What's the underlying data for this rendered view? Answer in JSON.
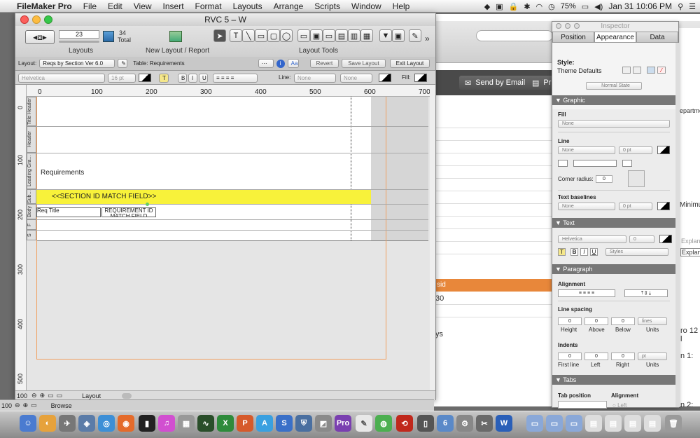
{
  "menubar": {
    "apple": "",
    "app": "FileMaker Pro",
    "items": [
      "File",
      "Edit",
      "View",
      "Insert",
      "Format",
      "Layouts",
      "Arrange",
      "Scripts",
      "Window",
      "Help"
    ],
    "battery": "75%",
    "clock": "Jan 31  10:06 PM"
  },
  "window": {
    "title": "RVC 5 – W",
    "layouts_count": "23",
    "layouts_label": "Layouts",
    "total_count": "34",
    "total_label": "Total",
    "new_layout_label": "New Layout / Report",
    "layout_tools_label": "Layout Tools",
    "layout_label": "Layout:",
    "layout_value": "Reqs by Section Ver 6.0",
    "table_label": "Table: Requirements",
    "revert": "Revert",
    "save_layout": "Save Layout",
    "exit_layout": "Exit Layout",
    "font": "Helvetica",
    "font_size": "16 pt",
    "line_label": "Line:",
    "line_value1": "None",
    "line_value2": "None",
    "fill_label": "Fill:"
  },
  "ruler": {
    "unit": "pt",
    "ticks": [
      "0",
      "100",
      "200",
      "300",
      "400",
      "500",
      "600",
      "700"
    ],
    "vticks": [
      "0",
      "100",
      "200",
      "300",
      "400",
      "500"
    ]
  },
  "layout": {
    "parts": [
      "Title Header",
      "Header",
      "Leading Gra...",
      "Sub...",
      "Body",
      "F",
      "S"
    ],
    "requirements_text": "Requirements",
    "section_field": "<<SECTION ID MATCH FIELD>>",
    "req_title_field": "Req Title",
    "req_id_field": "REQUIREMENT ID MATCH FIELD"
  },
  "statusbar": {
    "zoom": "100",
    "mode": "Layout"
  },
  "desktop": {
    "zoom": "100",
    "mode": "Browse"
  },
  "background": {
    "send_email": "Send by Email",
    "print": "Prin",
    "orange_cell": "sid",
    "cell_30": "30",
    "cell_ys": "ys",
    "department": "epartme",
    "minimum": "Minimu",
    "explana1": "Explana",
    "explana2": "Explana",
    "ro12": "ro 12 l",
    "n1": "n 1:",
    "n2": "n 2:"
  },
  "inspector": {
    "title": "Inspector",
    "tabs": [
      "Position",
      "Appearance",
      "Data"
    ],
    "style_label": "Style:",
    "style_value": "Theme Defaults",
    "state": "Normal State",
    "graphic": "Graphic",
    "fill": "Fill",
    "fill_value": "None",
    "line": "Line",
    "line_value": "None",
    "line_pt": "0 pt",
    "corner_radius": "Corner radius:",
    "corner_value": "0",
    "text_baselines": "Text baselines",
    "tb_value": "None",
    "tb_pt": "0 pt",
    "text_section": "Text",
    "text_font": "Helvetica",
    "text_size": "0",
    "styles": "Styles",
    "paragraph": "Paragraph",
    "alignment": "Alignment",
    "line_spacing": "Line spacing",
    "ls_height": "0",
    "ls_above": "0",
    "ls_below": "0",
    "ls_units": "lines",
    "height_lbl": "Height",
    "above_lbl": "Above",
    "below_lbl": "Below",
    "units_lbl": "Units",
    "indents": "Indents",
    "ind_first": "0",
    "ind_left": "0",
    "ind_right": "0",
    "ind_units": "pt",
    "first_line_lbl": "First line",
    "left_lbl": "Left",
    "right_lbl": "Right",
    "tabs_section": "Tabs",
    "tab_position": "Tab position",
    "tab_alignment": "Alignment",
    "tab_left": "Left"
  },
  "colors": {
    "yellow_field": "#f8f23a",
    "orange_header": "#e8873a",
    "dock_bg": "#a0a0a0"
  }
}
